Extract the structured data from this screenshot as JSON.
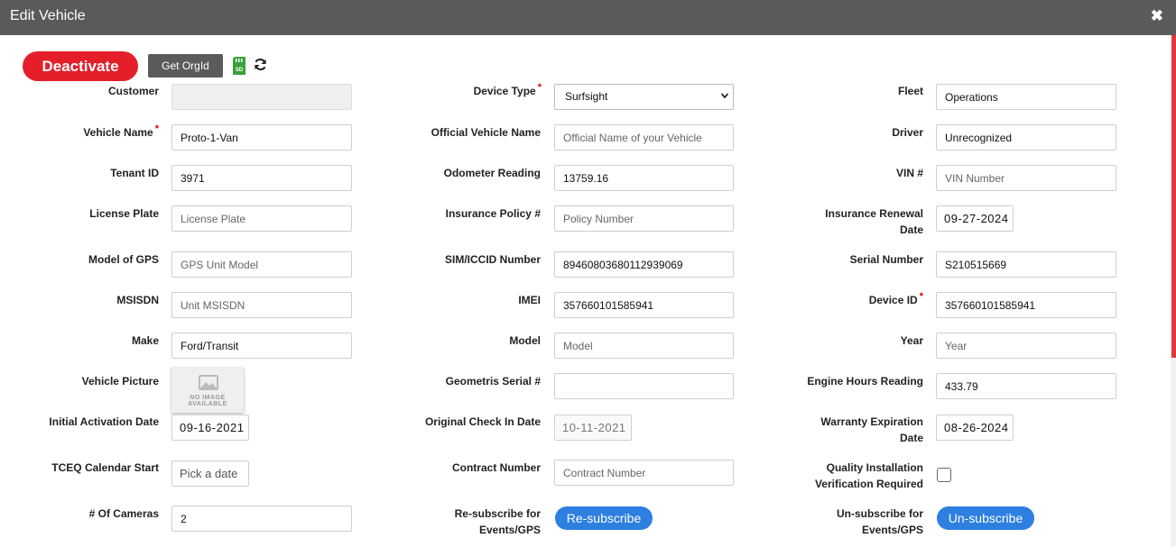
{
  "window": {
    "title": "Edit Vehicle",
    "close_glyph": "✖"
  },
  "toolbar": {
    "deactivate_label": "Deactivate",
    "get_orgid_label": "Get OrgId",
    "sd_label": "SD"
  },
  "image_placeholder": {
    "line1": "NO IMAGE",
    "line2": "AVAILABLE"
  },
  "colors": {
    "accent_red": "#e41f2a",
    "accent_blue": "#2d7fe0",
    "titlebar": "#5a5a5a"
  },
  "fields": {
    "customer": {
      "label": "Customer",
      "value": ""
    },
    "device_type": {
      "label": "Device Type",
      "value": "Surfsight"
    },
    "fleet": {
      "label": "Fleet",
      "value": "Operations"
    },
    "vehicle_name": {
      "label": "Vehicle Name",
      "value": "Proto-1-Van"
    },
    "official_vehicle_name": {
      "label": "Official Vehicle Name",
      "placeholder": "Official Name of your Vehicle"
    },
    "driver": {
      "label": "Driver",
      "value": "Unrecognized"
    },
    "tenant_id": {
      "label": "Tenant ID",
      "value": "3971"
    },
    "odometer": {
      "label": "Odometer Reading",
      "value": "13759.16"
    },
    "vin": {
      "label": "VIN #",
      "placeholder": "VIN Number"
    },
    "license_plate": {
      "label": "License Plate",
      "placeholder": "License Plate"
    },
    "insurance_policy": {
      "label": "Insurance Policy #",
      "placeholder": "Policy Number"
    },
    "insurance_renewal": {
      "label_1": "Insurance Renewal",
      "label_2": "Date",
      "value": "09-27-2024"
    },
    "model_of_gps": {
      "label": "Model of GPS",
      "placeholder": "GPS Unit Model"
    },
    "sim_iccid": {
      "label": "SIM/ICCID Number",
      "value": "89460803680112939069"
    },
    "serial_number": {
      "label": "Serial Number",
      "value": "S210515669"
    },
    "msisdn": {
      "label": "MSISDN",
      "placeholder": "Unit MSISDN"
    },
    "imei": {
      "label": "IMEI",
      "value": "357660101585941"
    },
    "device_id": {
      "label": "Device ID",
      "value": "357660101585941"
    },
    "make": {
      "label": "Make",
      "value": "Ford/Transit"
    },
    "model": {
      "label": "Model",
      "placeholder": "Model"
    },
    "year": {
      "label": "Year",
      "placeholder": "Year"
    },
    "vehicle_picture": {
      "label": "Vehicle Picture"
    },
    "geometris_serial": {
      "label": "Geometris Serial #",
      "value": ""
    },
    "engine_hours": {
      "label": "Engine Hours Reading",
      "value": "433.79"
    },
    "initial_activation": {
      "label": "Initial Activation Date",
      "value": "09-16-2021"
    },
    "original_check_in": {
      "label": "Original Check In Date",
      "value": "10-11-2021"
    },
    "warranty_expiration": {
      "label_1": "Warranty Expiration",
      "label_2": "Date",
      "value": "08-26-2024"
    },
    "tceq_calendar": {
      "label": "TCEQ Calendar Start",
      "placeholder": "Pick a date"
    },
    "contract_number": {
      "label": "Contract Number",
      "placeholder": "Contract Number"
    },
    "quality_installation": {
      "label_1": "Quality Installation",
      "label_2": "Verification Required",
      "checked": false
    },
    "num_cameras": {
      "label": "# Of Cameras",
      "value": "2"
    },
    "resubscribe": {
      "label_1": "Re-subscribe for",
      "label_2": "Events/GPS",
      "button": "Re-subscribe"
    },
    "unsubscribe": {
      "label_1": "Un-subscribe for",
      "label_2": "Events/GPS",
      "button": "Un-subscribe"
    }
  }
}
